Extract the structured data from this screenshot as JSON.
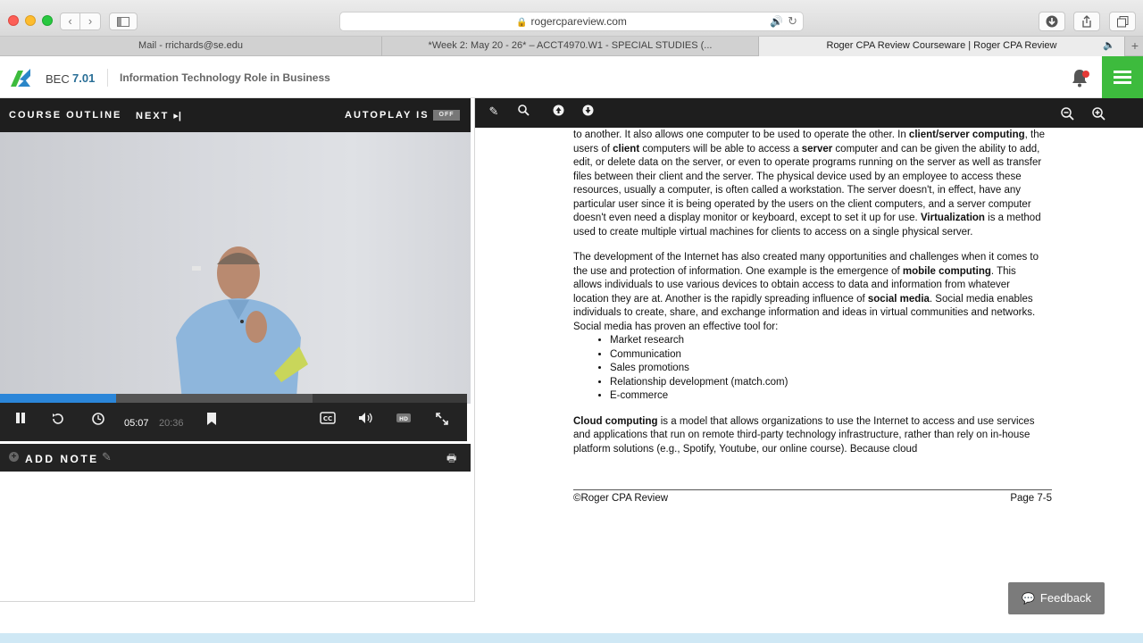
{
  "browser": {
    "url": "rogercpareview.com",
    "tabs": [
      {
        "label": "Mail - rrichards@se.edu"
      },
      {
        "label": "*Week 2: May 20 - 26* – ACCT4970.W1 - SPECIAL STUDIES (..."
      },
      {
        "label": "Roger CPA Review Courseware | Roger CPA Review"
      }
    ]
  },
  "header": {
    "course_code": "BEC",
    "course_number": "7.01",
    "title": "Information Technology Role in Business"
  },
  "video_panel": {
    "course_outline": "COURSE OUTLINE",
    "next": "NEXT",
    "autoplay_label": "AUTOPLAY IS",
    "autoplay_state": "OFF",
    "current_time": "05:07",
    "total_time": "20:36",
    "progress_fraction": 0.248,
    "add_note": "ADD NOTE"
  },
  "document": {
    "p1_a": "to another.  It also allows one computer to be used to operate the other.  In ",
    "p1_b": "client/server computing",
    "p1_c": ", the users of ",
    "p1_d": "client",
    "p1_e": " computers will be able to access a ",
    "p1_f": "server",
    "p1_g": " computer and can be given the ability to add, edit, or delete data on the server, or even to operate programs running on the server as well as transfer files between their client and the server.  The physical device used by an employee to access these resources, usually a computer, is often called a workstation.  The server doesn't, in effect, have any particular user since it is being operated by the users on the client computers, and a server computer doesn't even need a display monitor or keyboard, except to set it up for use. ",
    "p1_h": "Virtualization",
    "p1_i": " is a method used to create multiple virtual machines for clients to access on a single physical server.",
    "p2_a": "The development of the Internet has also created many opportunities and challenges when it comes to the use and protection of information.  One example is the emergence of ",
    "p2_b": "mobile computing",
    "p2_c": ".  This allows individuals to use various devices to obtain access to data and information from whatever location they are at.  Another is the rapidly spreading influence of ",
    "p2_d": "social media",
    "p2_e": ".  Social media enables individuals to create, share, and exchange information and ideas in virtual communities and networks.  Social media has proven an effective tool for:",
    "bullets": [
      "Market research",
      "Communication",
      "Sales promotions",
      "Relationship development (match.com)",
      "E-commerce"
    ],
    "p3_a": "Cloud computing",
    "p3_b": " is a model that allows organizations to use the Internet to access and use services and applications that run on remote third-party technology infrastructure, rather than rely on in-house platform solutions (e.g., Spotify, Youtube, our online course). Because cloud",
    "footer_left": "©Roger CPA Review",
    "footer_right": "Page 7-5"
  },
  "feedback_label": "Feedback",
  "colors": {
    "accent_green": "#3dbb3d",
    "progress_blue": "#2b86d9",
    "toolbar_dark": "#1e1e1e"
  }
}
